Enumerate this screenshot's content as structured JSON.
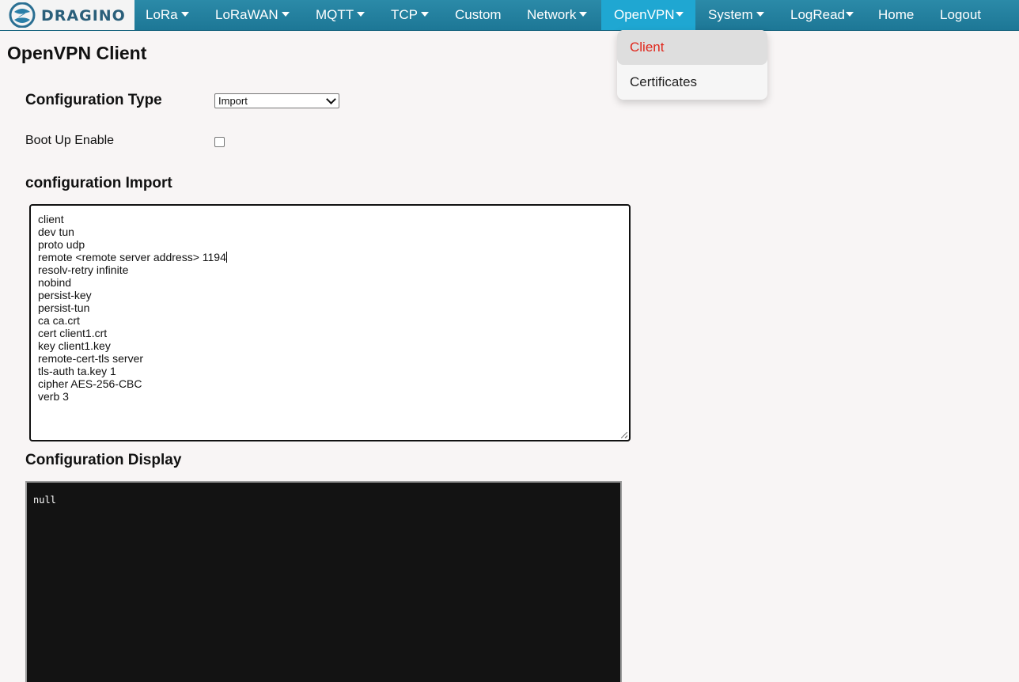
{
  "brand": {
    "name": "DRAGINO",
    "logo_icon": "dragino-logo-icon"
  },
  "nav": {
    "items": [
      {
        "label": "LoRa",
        "dropdown": true
      },
      {
        "label": "LoRaWAN",
        "dropdown": true
      },
      {
        "label": "MQTT",
        "dropdown": true
      },
      {
        "label": "TCP",
        "dropdown": true
      },
      {
        "label": "Custom",
        "dropdown": false
      },
      {
        "label": "Network",
        "dropdown": true
      },
      {
        "label": "OpenVPN",
        "dropdown": true,
        "active": true
      },
      {
        "label": "System",
        "dropdown": true
      },
      {
        "label": "LogRead",
        "dropdown": true
      },
      {
        "label": "Home",
        "dropdown": false
      },
      {
        "label": "Logout",
        "dropdown": false
      }
    ],
    "dropdown_menu": {
      "items": [
        {
          "label": "Client",
          "selected": true
        },
        {
          "label": "Certificates",
          "selected": false
        }
      ]
    }
  },
  "page": {
    "title": "OpenVPN Client"
  },
  "form": {
    "config_type_label": "Configuration Type",
    "config_type_value": "Import",
    "boot_up_label": "Boot Up Enable",
    "boot_up_checked": false,
    "import_label": "configuration Import",
    "import_lines": [
      "client",
      "dev tun",
      "proto udp",
      "remote <remote server address> 1194",
      "resolv-retry infinite",
      "nobind",
      "persist-key",
      "persist-tun",
      "ca ca.crt",
      "cert client1.crt",
      "key client1.key",
      "remote-cert-tls server",
      "tls-auth ta.key 1",
      "cipher AES-256-CBC",
      "verb 3"
    ],
    "display_label": "Configuration Display",
    "display_value": "null"
  },
  "colors": {
    "nav_bg": "#1d7796",
    "nav_active": "#1fa7d2",
    "selected_text": "#e0261b",
    "display_bg": "#131313"
  }
}
